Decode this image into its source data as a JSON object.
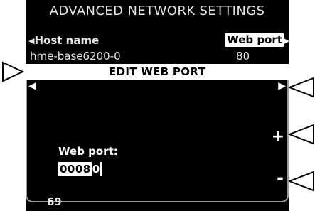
{
  "header": {
    "title": "ADVANCED NETWORK SETTINGS"
  },
  "tabs": {
    "left_label": "Host name",
    "active_label": "Web port",
    "left_arrow": "◀",
    "right_arrow": "▶"
  },
  "values": {
    "host_value": "hme-base6200-0",
    "port_value": "80"
  },
  "dialog": {
    "title": "EDIT WEB PORT",
    "nav_left": "◀",
    "nav_right": "▶",
    "field_label": "Web port:",
    "field_digits": "0008",
    "field_cursor_digit": "0",
    "plus_label": "+",
    "minus_label": "-"
  },
  "footer": {
    "number": "69"
  },
  "colors": {
    "screen_bg": "#000000",
    "text": "#e6e6e6",
    "highlight_bg": "#ffffff",
    "frame": "#9a9a9a"
  }
}
